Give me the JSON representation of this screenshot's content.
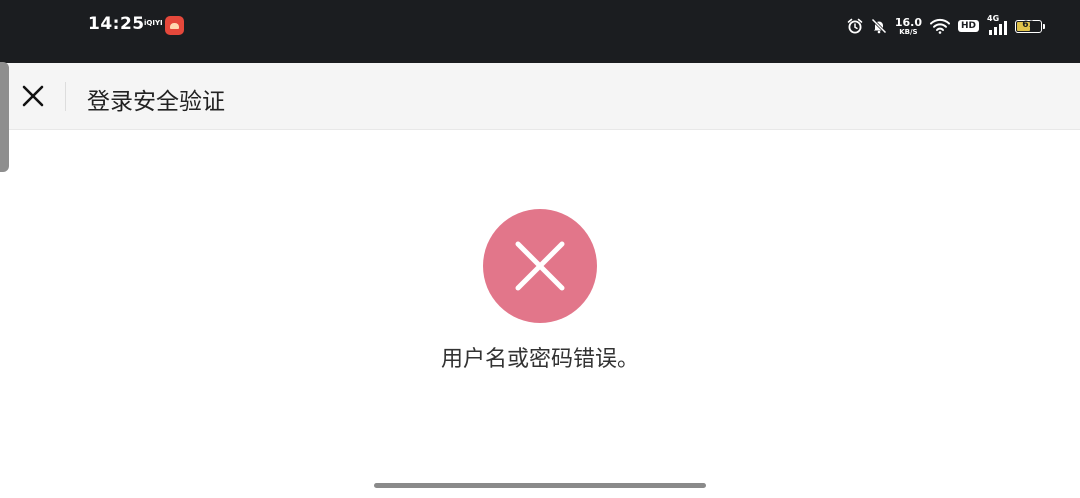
{
  "status_bar": {
    "time": "14:25",
    "app_tag": "iQIYI",
    "net_speed_value": "16.0",
    "net_speed_unit": "KB/S",
    "hd_label": "HD",
    "network_type": "4G",
    "battery_level": "61",
    "battery_fraction": 0.61,
    "battery_color": "#e0c24b",
    "icons": [
      "alarm-icon",
      "bell-muted-icon",
      "wifi-icon",
      "hd-badge",
      "signal-icon",
      "battery-icon"
    ]
  },
  "header": {
    "close_icon": "close-icon",
    "title": "登录安全验证"
  },
  "main": {
    "status_icon": "error-circle-icon",
    "status_color": "#e2768a",
    "message": "用户名或密码错误。"
  }
}
